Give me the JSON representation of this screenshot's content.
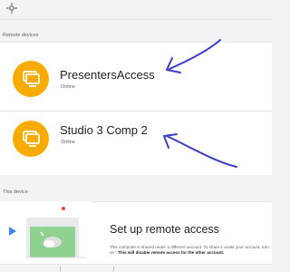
{
  "remote_devices": {
    "section_label": "Remote devices",
    "devices": [
      {
        "name": "PresentersAccess",
        "status": "Online",
        "icon": "monitor-icon"
      },
      {
        "name": "Studio 3 Comp 2",
        "status": "Online",
        "icon": "monitor-icon"
      }
    ]
  },
  "this_device": {
    "section_label": "This device",
    "title": "Set up remote access",
    "description": "This computer is shared under a different account. To share it under your account, turn on”.",
    "description_bold": "This will disable remote access for the other account.",
    "illustration": "laptop-illustration"
  },
  "colors": {
    "accent": "#f9ab00",
    "annotation": "#3a3ec6",
    "background": "#f1f3f4"
  }
}
